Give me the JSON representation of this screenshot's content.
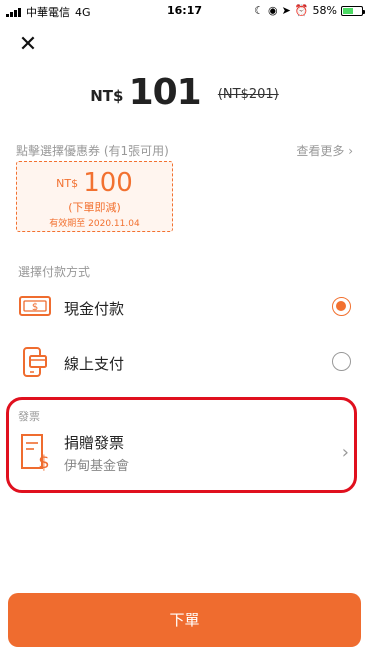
{
  "status_bar": {
    "carrier": "中華電信",
    "network": "4G",
    "time": "16:17",
    "battery": "58%",
    "battery_level": 0.58
  },
  "close_icon": "close-icon",
  "price": {
    "currency": "NT$",
    "amount": "101",
    "original": "(NT$201)"
  },
  "coupon": {
    "hint": "點擊選擇優惠券 (有1張可用)",
    "see_more": "查看更多 ›",
    "currency": "NT$",
    "amount": "100",
    "description": "(下單即減)",
    "validity": "有效期至 2020.11.04"
  },
  "payment": {
    "title": "選擇付款方式",
    "options": [
      {
        "label": "現金付款",
        "icon": "cash-icon",
        "selected": true
      },
      {
        "label": "線上支付",
        "icon": "mobile-payment-icon",
        "selected": false
      }
    ]
  },
  "invoice": {
    "title": "發票",
    "label": "捐贈發票",
    "sub": "伊甸基金會",
    "icon": "invoice-icon"
  },
  "submit_label": "下單",
  "colors": {
    "accent": "#ef6c2f",
    "highlight": "#e0101e"
  }
}
